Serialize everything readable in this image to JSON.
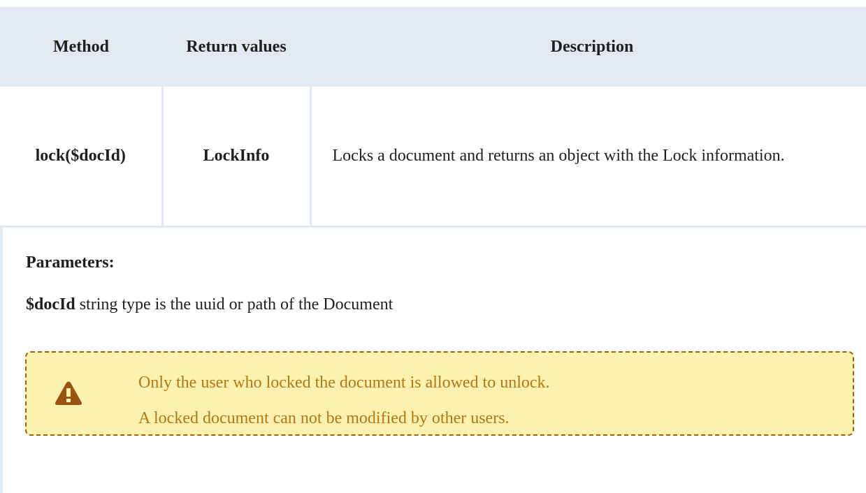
{
  "table": {
    "headers": {
      "method": "Method",
      "return_values": "Return values",
      "description": "Description"
    },
    "rows": [
      {
        "method": "lock($docId)",
        "return_value": "LockInfo",
        "description": "Locks a document and returns an object with the Lock information."
      }
    ]
  },
  "parameters": {
    "title": "Parameters:",
    "items": [
      {
        "name": "$docId",
        "text": "string type is the uuid or path of the Document"
      }
    ]
  },
  "warning": {
    "icon": "warning-icon",
    "color": "#b07817",
    "background": "#fdf1b0",
    "border_color": "#9a6110",
    "lines": [
      "Only the user who locked the document is allowed to unlock.",
      "A locked document can not be modified by other users."
    ]
  },
  "colors": {
    "header_bg": "#e3e9f1",
    "text": "#1f1f1f"
  }
}
